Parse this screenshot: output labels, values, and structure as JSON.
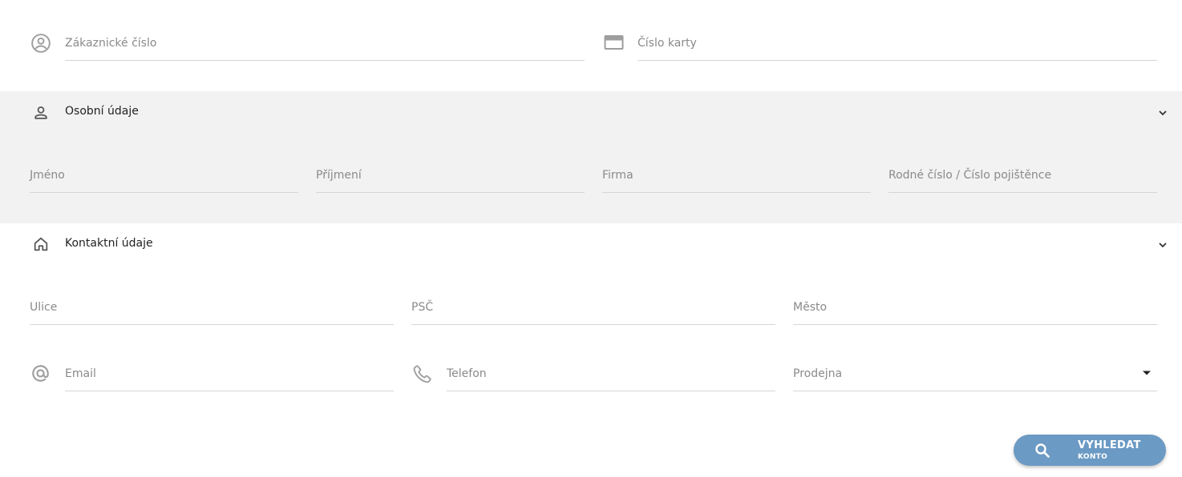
{
  "search_top": {
    "customer_number": {
      "placeholder": "Zákaznické číslo",
      "icon": "account-circle-icon"
    },
    "card_number": {
      "placeholder": "Číslo karty",
      "icon": "credit-card-icon"
    }
  },
  "personal_section": {
    "title": "Osobní údaje",
    "icon": "person-icon",
    "expanded": true,
    "fields": {
      "first_name": "Jméno",
      "last_name": "Příjmení",
      "company": "Firma",
      "birth_number": "Rodné číslo / Číslo pojištěnce"
    }
  },
  "contact_section": {
    "title": "Kontaktní údaje",
    "icon": "home-icon",
    "expanded": true,
    "fields": {
      "street": "Ulice",
      "zip": "PSČ",
      "city": "Město",
      "email": "Email",
      "phone": "Telefon",
      "store": "Prodejna"
    }
  },
  "search_button": {
    "label": "VYHLEDAT",
    "sublabel": "KONTO",
    "color": "#6b9ac4"
  },
  "colors": {
    "section_background": "#f2f2f2",
    "field_label": "#8a8a8a",
    "icon": "#9e9e9e"
  }
}
